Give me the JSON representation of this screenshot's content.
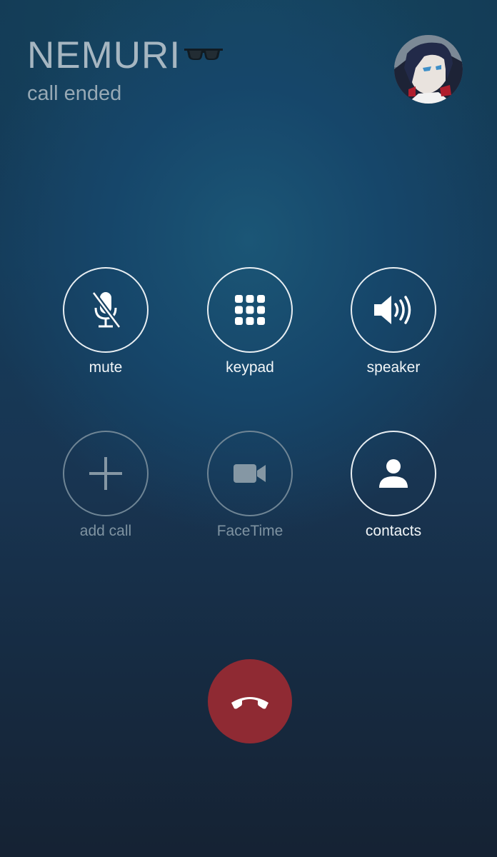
{
  "header": {
    "caller_name": "NEMURI",
    "caller_emoji": "sunglasses-icon",
    "call_status": "call ended"
  },
  "controls": {
    "mute": {
      "label": "mute",
      "icon": "microphone-muted-icon",
      "enabled": true
    },
    "keypad": {
      "label": "keypad",
      "icon": "keypad-dots-icon",
      "enabled": true
    },
    "speaker": {
      "label": "speaker",
      "icon": "speaker-icon",
      "enabled": true
    },
    "add_call": {
      "label": "add call",
      "icon": "plus-icon",
      "enabled": false
    },
    "facetime": {
      "label": "FaceTime",
      "icon": "video-camera-icon",
      "enabled": false
    },
    "contacts": {
      "label": "contacts",
      "icon": "person-icon",
      "enabled": true
    }
  },
  "end_call": {
    "icon": "phone-hangup-icon"
  },
  "colors": {
    "background_top": "#143a55",
    "background_bottom": "#152233",
    "ring_enabled": "#e8eef2",
    "ring_disabled": "#6f8595",
    "end_call_red": "#8f2a33"
  }
}
